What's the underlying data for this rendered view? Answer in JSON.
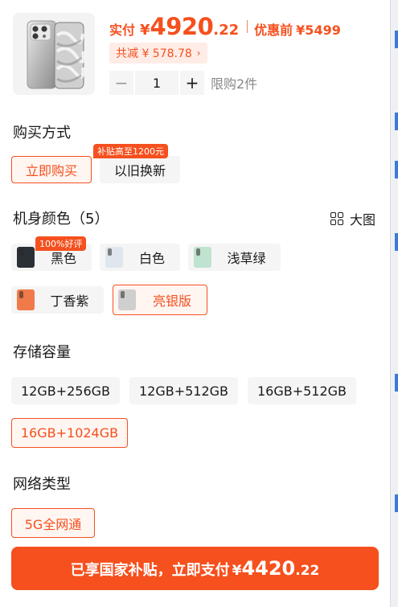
{
  "colors": {
    "accent": "#f5501e",
    "accent_light": "#fff6f2",
    "option_bg": "#f5f5f5"
  },
  "header": {
    "paid_label": "实付",
    "currency": "¥",
    "price_int": "4920",
    "price_dec": ".22",
    "before_label": "优惠前",
    "before_value": "¥5499",
    "discount_label": "共减 ¥ 578.78",
    "discount_chevron": "›",
    "quantity": "1",
    "minus": "−",
    "plus": "+",
    "limit_text": "限购2件"
  },
  "purchase": {
    "title": "购买方式",
    "options": [
      {
        "label": "立即购买",
        "selected": true
      },
      {
        "label": "以旧换新",
        "selected": false
      }
    ],
    "badge": "补贴高至1200元"
  },
  "color": {
    "title": "机身颜色（5）",
    "big_pic_label": "大图",
    "badge": "100%好评",
    "options": [
      {
        "label": "黑色",
        "swatch": "#2b2f36",
        "selected": false
      },
      {
        "label": "白色",
        "swatch": "#dfe6ee",
        "selected": false
      },
      {
        "label": "浅草绿",
        "swatch": "#bfe3cf",
        "selected": false
      },
      {
        "label": "丁香紫",
        "swatch": "#f07a4a",
        "selected": false
      },
      {
        "label": "亮银版",
        "swatch": "#cfcfcf",
        "selected": true
      }
    ]
  },
  "storage": {
    "title": "存储容量",
    "options": [
      {
        "label": "12GB+256GB",
        "selected": false
      },
      {
        "label": "12GB+512GB",
        "selected": false
      },
      {
        "label": "16GB+512GB",
        "selected": false
      },
      {
        "label": "16GB+1024GB",
        "selected": true
      }
    ]
  },
  "network": {
    "title": "网络类型",
    "options": [
      {
        "label": "5G全网通",
        "selected": true
      }
    ]
  },
  "pay_button": {
    "label": "已享国家补贴，立即支付",
    "currency": "¥",
    "price_int": "4420",
    "price_dec": ".22"
  }
}
